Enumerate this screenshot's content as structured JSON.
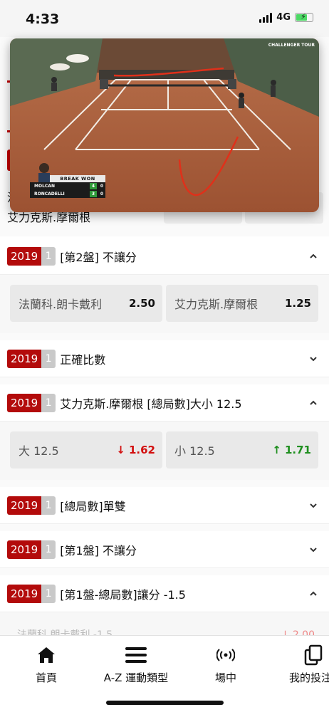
{
  "status_bar": {
    "time": "4:33",
    "network": "4G"
  },
  "background": {
    "line1": "法",
    "line2": "艾力克斯.摩爾根"
  },
  "video": {
    "break_label": "BREAK WON",
    "players": [
      {
        "name": "MOLCAN",
        "games": "4",
        "points": "0"
      },
      {
        "name": "RONCADELLI",
        "games": "3",
        "points": "0"
      }
    ],
    "tour_logo": "CHALLENGER TOUR"
  },
  "markets": [
    {
      "year": "2019",
      "num": "1",
      "title": "[第2盤] 不讓分",
      "expanded": true,
      "odds": [
        {
          "label": "法蘭科.朗卡戴利",
          "value": "2.50",
          "trend": ""
        },
        {
          "label": "艾力克斯.摩爾根",
          "value": "1.25",
          "trend": ""
        }
      ]
    },
    {
      "year": "2019",
      "num": "1",
      "title": "正確比數",
      "expanded": false
    },
    {
      "year": "2019",
      "num": "1",
      "title": "艾力克斯.摩爾根 [總局數]大小 12.5",
      "expanded": true,
      "odds": [
        {
          "label": "大 12.5",
          "value": "↓ 1.62",
          "trend": "down"
        },
        {
          "label": "小 12.5",
          "value": "↑ 1.71",
          "trend": "up"
        }
      ]
    },
    {
      "year": "2019",
      "num": "1",
      "title": "[總局數]單雙",
      "expanded": false
    },
    {
      "year": "2019",
      "num": "1",
      "title": "[第1盤] 不讓分",
      "expanded": false
    },
    {
      "year": "2019",
      "num": "1",
      "title": "[第1盤-總局數]讓分 -1.5",
      "expanded": true,
      "partial": {
        "left": "法蘭科.朗卡戴利 -1.5",
        "right": "↓ 2.00"
      }
    }
  ],
  "bottom_nav": [
    {
      "label": "首頁",
      "icon": "home-icon"
    },
    {
      "label": "A-Z 運動類型",
      "icon": "menu-icon"
    },
    {
      "label": "場中",
      "icon": "live-broadcast-icon"
    },
    {
      "label": "我的投注",
      "icon": "bets-copy-icon"
    }
  ],
  "colors": {
    "accent": "#b30b0b",
    "down": "#d20f0f",
    "up": "#1f8f1f"
  }
}
